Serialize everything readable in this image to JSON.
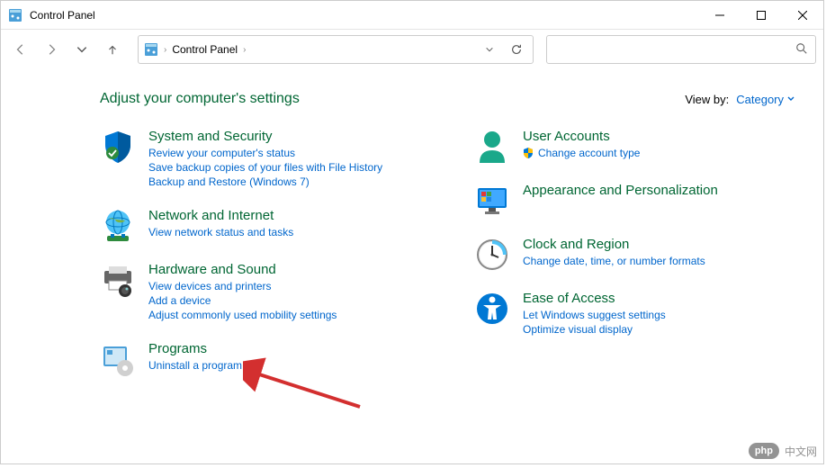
{
  "window": {
    "title": "Control Panel"
  },
  "addressbar": {
    "text": "Control Panel"
  },
  "search": {
    "placeholder": ""
  },
  "heading": "Adjust your computer's settings",
  "view_by": {
    "label": "View by:",
    "value": "Category"
  },
  "categories": {
    "system_security": {
      "title": "System and Security",
      "links": [
        "Review your computer's status",
        "Save backup copies of your files with File History",
        "Backup and Restore (Windows 7)"
      ]
    },
    "network": {
      "title": "Network and Internet",
      "links": [
        "View network status and tasks"
      ]
    },
    "hardware": {
      "title": "Hardware and Sound",
      "links": [
        "View devices and printers",
        "Add a device",
        "Adjust commonly used mobility settings"
      ]
    },
    "programs": {
      "title": "Programs",
      "links": [
        "Uninstall a program"
      ]
    },
    "user_accounts": {
      "title": "User Accounts",
      "links": [
        "Change account type"
      ]
    },
    "appearance": {
      "title": "Appearance and Personalization",
      "links": []
    },
    "clock": {
      "title": "Clock and Region",
      "links": [
        "Change date, time, or number formats"
      ]
    },
    "ease": {
      "title": "Ease of Access",
      "links": [
        "Let Windows suggest settings",
        "Optimize visual display"
      ]
    }
  },
  "watermark": {
    "badge": "php",
    "text": "中文网"
  }
}
